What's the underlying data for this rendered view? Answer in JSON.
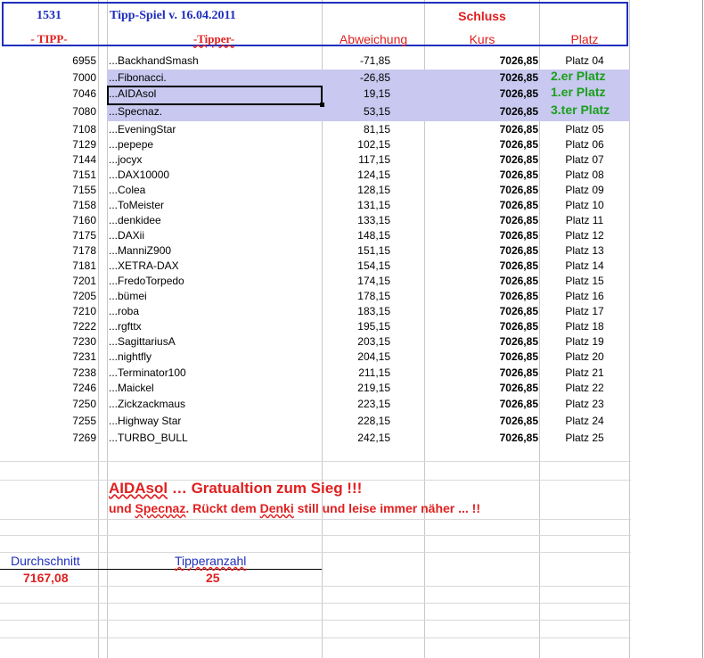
{
  "header": {
    "id": "1531",
    "title": "Tipp-Spiel v. 16.04.2011",
    "schluss": "Schluss",
    "col_tipp": "- TIPP-",
    "col_tipper": "-Tipper-",
    "col_abweichung": "Abweichung",
    "col_kurs": "Kurs",
    "col_platz": "Platz"
  },
  "rows": [
    {
      "tipp": "6955",
      "tipper": "...BackhandSmash",
      "abw": "-71,85",
      "kurs": "7026,85",
      "platz": "Platz 04"
    },
    {
      "tipp": "7000",
      "tipper": "...Fibonacci.",
      "abw": "-26,85",
      "kurs": "7026,85",
      "platz": "2.er Platz"
    },
    {
      "tipp": "7046",
      "tipper": "...AIDAsol",
      "abw": "19,15",
      "kurs": "7026,85",
      "platz": "1.er Platz"
    },
    {
      "tipp": "7080",
      "tipper": "...Specnaz.",
      "abw": "53,15",
      "kurs": "7026,85",
      "platz": "3.ter Platz"
    },
    {
      "tipp": "7108",
      "tipper": "...EveningStar",
      "abw": "81,15",
      "kurs": "7026,85",
      "platz": "Platz 05"
    },
    {
      "tipp": "7129",
      "tipper": "...pepepe",
      "abw": "102,15",
      "kurs": "7026,85",
      "platz": "Platz 06"
    },
    {
      "tipp": "7144",
      "tipper": "...jocyx",
      "abw": "117,15",
      "kurs": "7026,85",
      "platz": "Platz 07"
    },
    {
      "tipp": "7151",
      "tipper": "...DAX10000",
      "abw": "124,15",
      "kurs": "7026,85",
      "platz": "Platz 08"
    },
    {
      "tipp": "7155",
      "tipper": "...Colea",
      "abw": "128,15",
      "kurs": "7026,85",
      "platz": "Platz 09"
    },
    {
      "tipp": "7158",
      "tipper": "...ToMeister",
      "abw": "131,15",
      "kurs": "7026,85",
      "platz": "Platz 10"
    },
    {
      "tipp": "7160",
      "tipper": "...denkidee",
      "abw": "133,15",
      "kurs": "7026,85",
      "platz": "Platz 11"
    },
    {
      "tipp": "7175",
      "tipper": "...DAXii",
      "abw": "148,15",
      "kurs": "7026,85",
      "platz": "Platz 12"
    },
    {
      "tipp": "7178",
      "tipper": "...ManniZ900",
      "abw": "151,15",
      "kurs": "7026,85",
      "platz": "Platz 13"
    },
    {
      "tipp": "7181",
      "tipper": "...XETRA-DAX",
      "abw": "154,15",
      "kurs": "7026,85",
      "platz": "Platz 14"
    },
    {
      "tipp": "7201",
      "tipper": "...FredoTorpedo",
      "abw": "174,15",
      "kurs": "7026,85",
      "platz": "Platz 15"
    },
    {
      "tipp": "7205",
      "tipper": "...bümei",
      "abw": "178,15",
      "kurs": "7026,85",
      "platz": "Platz 16"
    },
    {
      "tipp": "7210",
      "tipper": "...roba",
      "abw": "183,15",
      "kurs": "7026,85",
      "platz": "Platz 17"
    },
    {
      "tipp": "7222",
      "tipper": "...rgfttx",
      "abw": "195,15",
      "kurs": "7026,85",
      "platz": "Platz 18"
    },
    {
      "tipp": "7230",
      "tipper": "...SagittariusA",
      "abw": "203,15",
      "kurs": "7026,85",
      "platz": "Platz 19"
    },
    {
      "tipp": "7231",
      "tipper": "...nightfly",
      "abw": "204,15",
      "kurs": "7026,85",
      "platz": "Platz 20"
    },
    {
      "tipp": "7238",
      "tipper": "...Terminator100",
      "abw": "211,15",
      "kurs": "7026,85",
      "platz": "Platz 21"
    },
    {
      "tipp": "7246",
      "tipper": "...Maickel",
      "abw": "219,15",
      "kurs": "7026,85",
      "platz": "Platz 22"
    },
    {
      "tipp": "7250",
      "tipper": "...Zickzackmaus",
      "abw": "223,15",
      "kurs": "7026,85",
      "platz": "Platz 23"
    },
    {
      "tipp": "7255",
      "tipper": "...Highway Star",
      "abw": "228,15",
      "kurs": "7026,85",
      "platz": "Platz 24"
    },
    {
      "tipp": "7269",
      "tipper": "...TURBO_BULL",
      "abw": "242,15",
      "kurs": "7026,85",
      "platz": "Platz 25"
    }
  ],
  "message": {
    "line1_name": "AIDAsol",
    "line1_rest": " … Gratualtion zum Sieg !!!",
    "line2_a": "und ",
    "line2_b": "Specnaz",
    "line2_c": ". Rückt dem ",
    "line2_d": "Denki",
    "line2_e": " still und leise immer näher ... !!"
  },
  "footer": {
    "avg_label": "Durchschnitt",
    "avg_value": "7167,08",
    "count_label": "Tipperanzahl",
    "count_value": "25"
  },
  "colors": {
    "header_blue": "#1f2fbd",
    "text_red": "#e02020",
    "podium_green": "#1aa01a",
    "highlight": "#c8c8f0"
  }
}
